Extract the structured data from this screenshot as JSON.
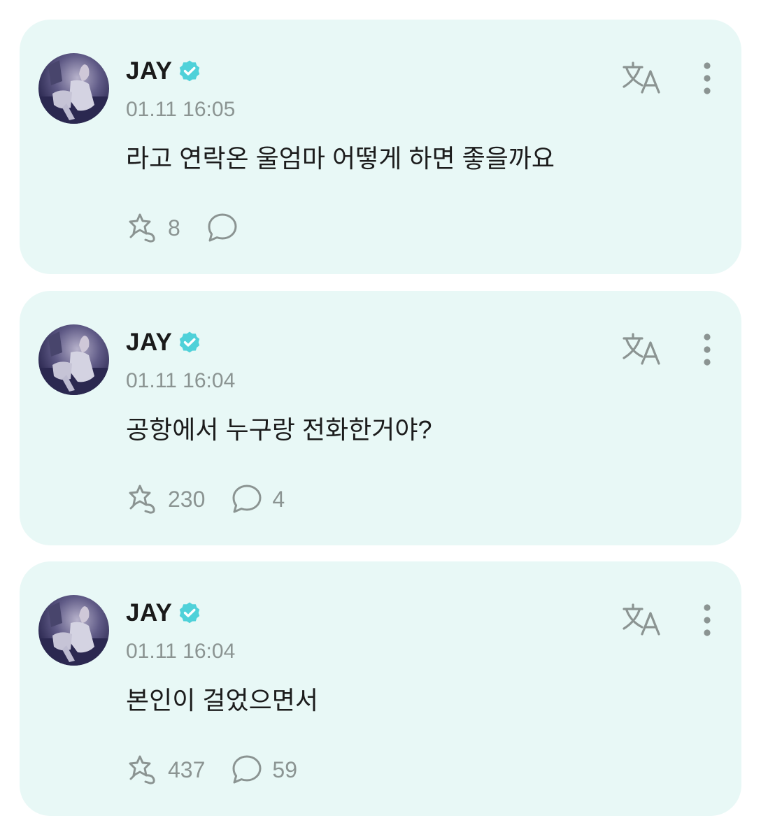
{
  "posts": [
    {
      "author": "JAY",
      "timestamp": "01.11 16:05",
      "text": "라고 연락온 울엄마 어떻게 하면 좋을까요",
      "like_count": "8",
      "comment_count": ""
    },
    {
      "author": "JAY",
      "timestamp": "01.11 16:04",
      "text": "공항에서 누구랑 전화한거야?",
      "like_count": "230",
      "comment_count": "4"
    },
    {
      "author": "JAY",
      "timestamp": "01.11 16:04",
      "text": "본인이 걸었으면서",
      "like_count": "437",
      "comment_count": "59"
    }
  ],
  "icons": {
    "verified": "verified-badge-icon",
    "translate": "translate-icon",
    "more": "more-vertical-icon",
    "like": "like-sparkle-icon",
    "comment": "comment-bubble-icon"
  },
  "colors": {
    "card_background": "#e8f8f6",
    "verified_badge": "#4fd1d9",
    "icon_gray": "#8b9492",
    "text_primary": "#1c1c1c"
  }
}
